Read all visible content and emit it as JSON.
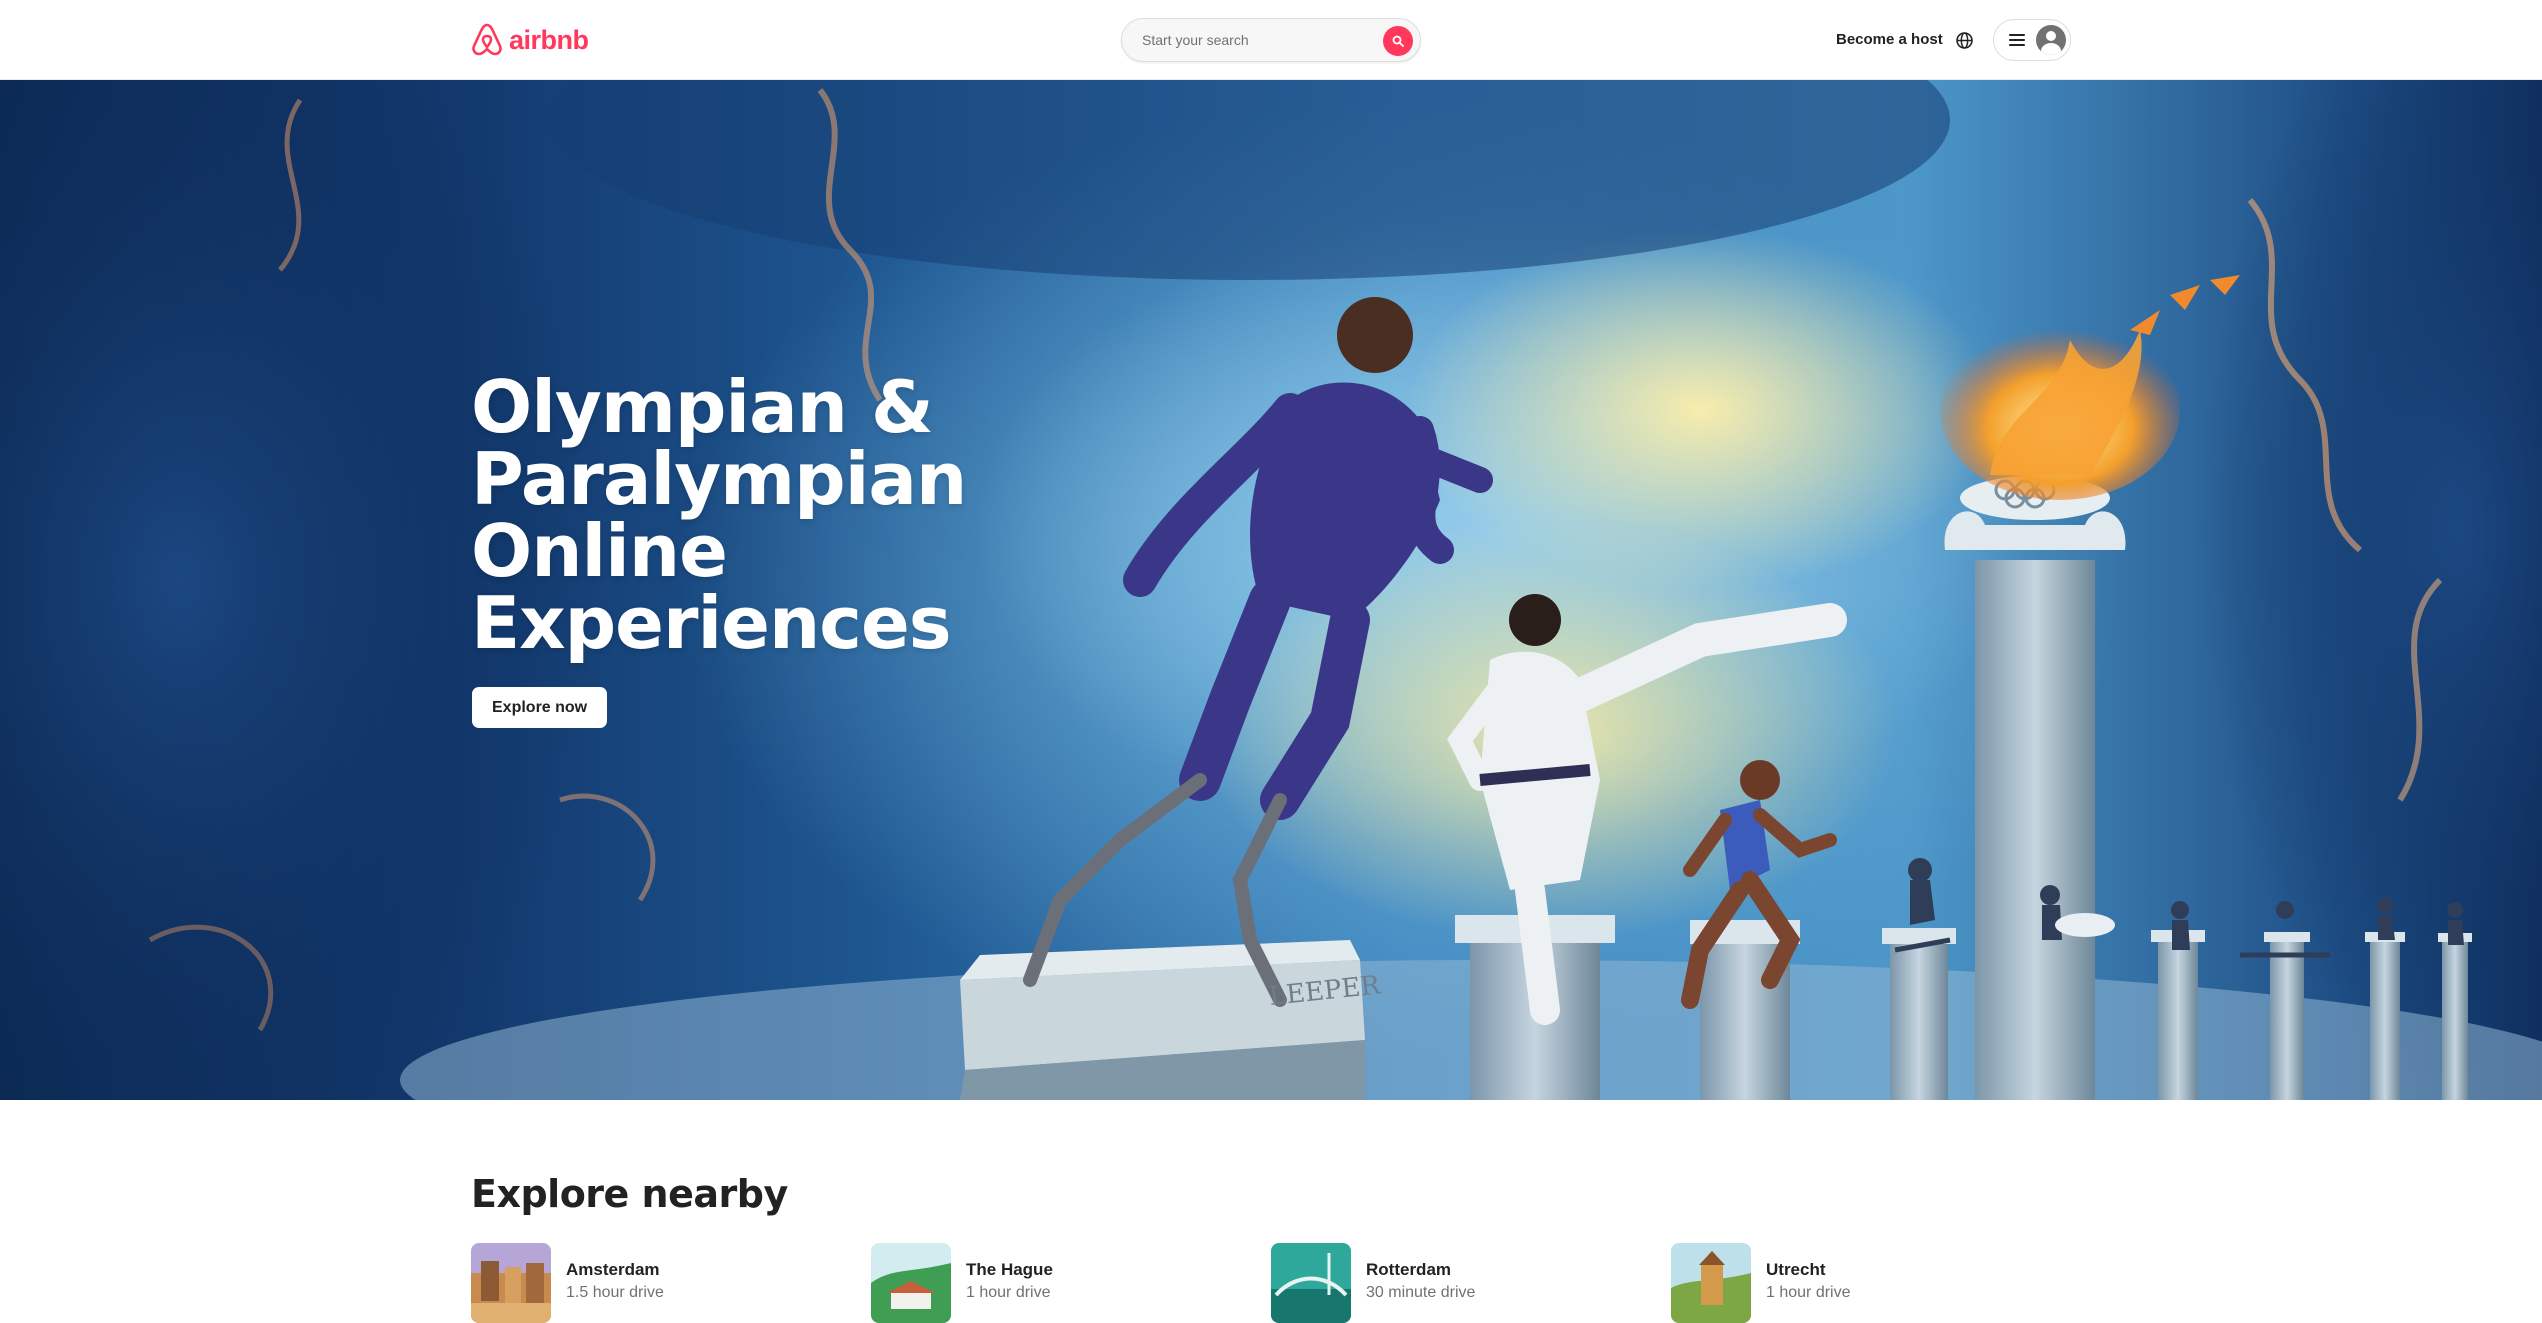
{
  "header": {
    "logo_text": "airbnb",
    "search_placeholder": "Start your search",
    "become_host": "Become a host"
  },
  "hero": {
    "title": "Olympian & Paralymplan Online Experiences",
    "title_lines": [
      "Olympian &",
      "Paralympian",
      "Online",
      "Experiences"
    ],
    "cta": "Explore now",
    "podium_engraving": "LEEPER"
  },
  "nearby": {
    "title": "Explore nearby",
    "items": [
      {
        "name": "Amsterdam",
        "distance": "1.5 hour drive"
      },
      {
        "name": "The Hague",
        "distance": "1 hour drive"
      },
      {
        "name": "Rotterdam",
        "distance": "30 minute drive"
      },
      {
        "name": "Utrecht",
        "distance": "1 hour drive"
      }
    ]
  },
  "colors": {
    "brand": "#ff385c",
    "text": "#222222",
    "muted": "#717171"
  }
}
